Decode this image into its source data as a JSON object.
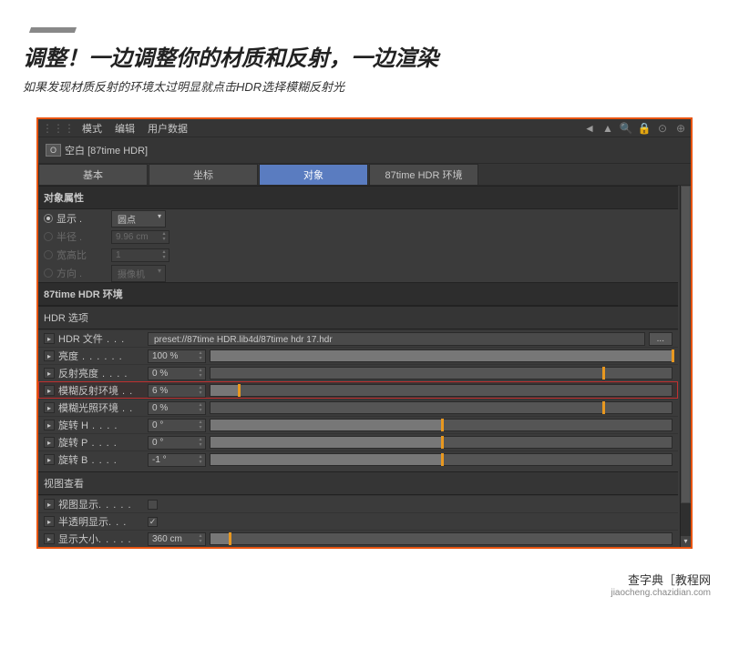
{
  "page": {
    "title": "调整！一边调整你的材质和反射，一边渲染",
    "subtitle": "如果发现材质反射的环境太过明显就点击HDR选择模糊反射光"
  },
  "toolbar": {
    "menus": [
      "模式",
      "编辑",
      "用户数据"
    ]
  },
  "object": {
    "badge": "O",
    "title": "空白 [87time HDR]"
  },
  "tabs": [
    {
      "label": "基本",
      "active": false
    },
    {
      "label": "坐标",
      "active": false
    },
    {
      "label": "对象",
      "active": true
    },
    {
      "label": "87time HDR 环境",
      "active": false
    }
  ],
  "sections": {
    "obj_props": "对象属性",
    "hdr_env": "87time HDR 环境",
    "hdr_opts": "HDR 选项",
    "viewport": "视图查看"
  },
  "display": {
    "label": "显示 .",
    "value": "圆点",
    "radius_label": "半径 .",
    "radius_value": "9.96 cm",
    "aspect_label": "宽高比",
    "aspect_value": "1",
    "orient_label": "方向 .",
    "orient_value": "摄像机"
  },
  "hdr": {
    "file_label": "HDR 文件",
    "file_value": "preset://87time HDR.lib4d/87time hdr 17.hdr",
    "browse": "...",
    "params": [
      {
        "label": "亮度",
        "value": "100 %",
        "fill": 100,
        "marker": 100
      },
      {
        "label": "反射亮度",
        "value": "0 %",
        "fill": 0,
        "marker": 85
      },
      {
        "label": "模糊反射环境",
        "value": "6 %",
        "fill": 6,
        "marker": 6,
        "highlighted": true
      },
      {
        "label": "模糊光照环境",
        "value": "0 %",
        "fill": 0,
        "marker": 85
      },
      {
        "label": "旋转 H",
        "value": "0 °",
        "fill": 50,
        "marker": 50
      },
      {
        "label": "旋转 P",
        "value": "0 °",
        "fill": 50,
        "marker": 50
      },
      {
        "label": "旋转 B",
        "value": "-1 °",
        "fill": 50,
        "marker": 50
      }
    ]
  },
  "viewport": {
    "editor_label": "视图显示",
    "trans_label": "半透明显示",
    "size_label": "显示大小",
    "size_value": "360 cm"
  },
  "footer": {
    "main": "查字典［教程网",
    "sub": "jiaocheng.chazidian.com"
  }
}
